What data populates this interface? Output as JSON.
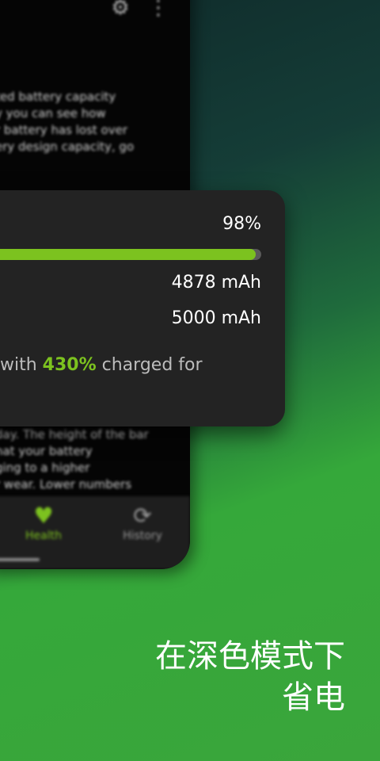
{
  "phone": {
    "top_icons": [
      "settings-icon",
      "more-vert-icon"
    ],
    "text_top": "ted battery capacity\ny you can see how\nr battery has lost over\nery design capacity, go",
    "text_bottom": "day. The height of the bar\nhat your battery\nging to a higher\nr wear. Lower numbers",
    "nav": {
      "health_label": "Health",
      "history_label": "History"
    },
    "colors": {
      "accent": "#7cc21f",
      "inactive": "#9a9a9a"
    }
  },
  "card": {
    "percent": "98%",
    "health_fraction": 0.98,
    "current_capacity": "4878 mAh",
    "design_capacity": "5000 mAh",
    "charged_prefix": "with ",
    "charged_value": "430%",
    "charged_suffix": " charged for"
  },
  "caption": {
    "line1": "在深色模式下",
    "line2": "省电"
  }
}
